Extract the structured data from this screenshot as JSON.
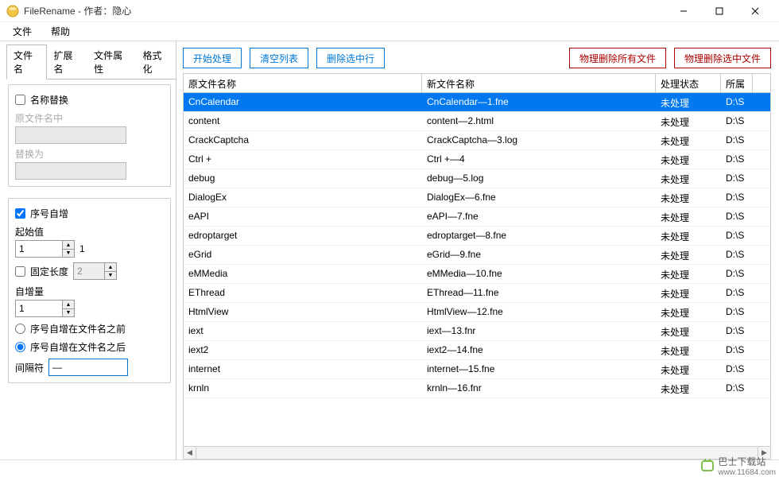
{
  "window": {
    "title": "FileRename - 作者：隐心"
  },
  "menu": {
    "file": "文件",
    "help": "帮助"
  },
  "tabs": {
    "filename": "文件名",
    "extension": "扩展名",
    "attributes": "文件属性",
    "format": "格式化"
  },
  "replace_group": {
    "checkbox": "名称替换",
    "from_label": "原文件名中",
    "from_value": "",
    "to_label": "替换为",
    "to_value": ""
  },
  "seq_group": {
    "checkbox": "序号自增",
    "start_label": "起始值",
    "start_value": "1",
    "start_side": "1",
    "fixed_length_label": "固定长度",
    "fixed_length_value": "2",
    "increment_label": "自增量",
    "increment_value": "1",
    "radio_before": "序号自增在文件名之前",
    "radio_after": "序号自增在文件名之后",
    "separator_label": "间隔符",
    "separator_value": "—"
  },
  "toolbar": {
    "start": "开始处理",
    "clear": "清空列表",
    "delete_selected": "删除选中行",
    "delete_all_phys": "物理删除所有文件",
    "delete_selected_phys": "物理删除选中文件"
  },
  "table": {
    "headers": {
      "old": "原文件名称",
      "new": "新文件名称",
      "status": "处理状态",
      "dir": "所属"
    },
    "rows": [
      {
        "old": "CnCalendar",
        "new": "CnCalendar—1.fne",
        "status": "未处理",
        "dir": "D:\\S",
        "selected": true
      },
      {
        "old": "content",
        "new": "content—2.html",
        "status": "未处理",
        "dir": "D:\\S"
      },
      {
        "old": "CrackCaptcha",
        "new": "CrackCaptcha—3.log",
        "status": "未处理",
        "dir": "D:\\S"
      },
      {
        "old": "Ctrl  +",
        "new": "Ctrl  +—4",
        "status": "未处理",
        "dir": "D:\\S"
      },
      {
        "old": "debug",
        "new": "debug—5.log",
        "status": "未处理",
        "dir": "D:\\S"
      },
      {
        "old": "DialogEx",
        "new": "DialogEx—6.fne",
        "status": "未处理",
        "dir": "D:\\S"
      },
      {
        "old": "eAPI",
        "new": "eAPI—7.fne",
        "status": "未处理",
        "dir": "D:\\S"
      },
      {
        "old": "edroptarget",
        "new": "edroptarget—8.fne",
        "status": "未处理",
        "dir": "D:\\S"
      },
      {
        "old": "eGrid",
        "new": "eGrid—9.fne",
        "status": "未处理",
        "dir": "D:\\S"
      },
      {
        "old": "eMMedia",
        "new": "eMMedia—10.fne",
        "status": "未处理",
        "dir": "D:\\S"
      },
      {
        "old": "EThread",
        "new": "EThread—11.fne",
        "status": "未处理",
        "dir": "D:\\S"
      },
      {
        "old": "HtmlView",
        "new": "HtmlView—12.fne",
        "status": "未处理",
        "dir": "D:\\S"
      },
      {
        "old": "iext",
        "new": "iext—13.fnr",
        "status": "未处理",
        "dir": "D:\\S"
      },
      {
        "old": "iext2",
        "new": "iext2—14.fne",
        "status": "未处理",
        "dir": "D:\\S"
      },
      {
        "old": "internet",
        "new": "internet—15.fne",
        "status": "未处理",
        "dir": "D:\\S"
      },
      {
        "old": "krnln",
        "new": "krnln—16.fnr",
        "status": "未处理",
        "dir": "D:\\S"
      }
    ]
  },
  "watermark": {
    "text": "巴士下载站",
    "url": "www.11684.com"
  }
}
